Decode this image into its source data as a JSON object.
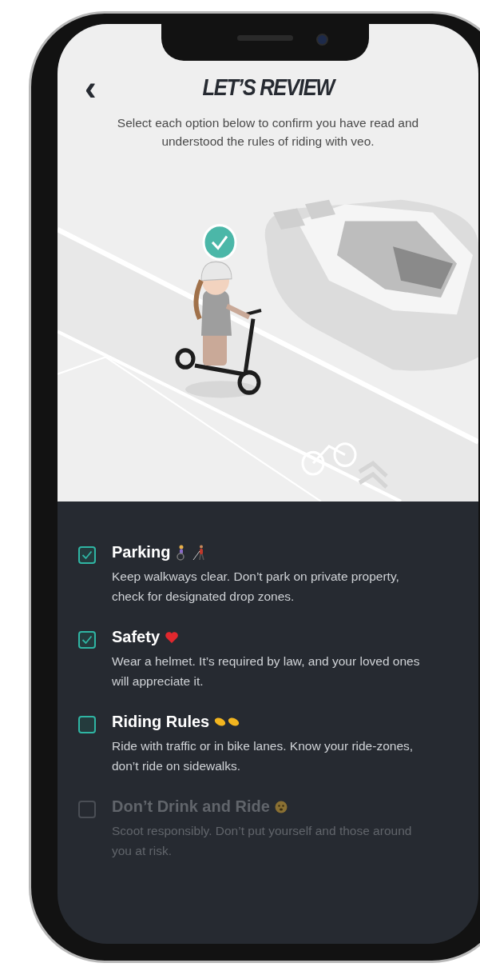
{
  "header": {
    "back": "‹",
    "title": "LET’S REVIEW",
    "subtitle": "Select each option below to confirm you have read and understood the rules of riding with veo."
  },
  "items": [
    {
      "title": "Parking",
      "description": "Keep walkways clear. Don’t park on private property, check for designated drop zones.",
      "checked": true,
      "disabled": false
    },
    {
      "title": "Safety",
      "description": "Wear a helmet. It’s required by law, and your loved ones will appreciate it.",
      "checked": true,
      "disabled": false
    },
    {
      "title": "Riding Rules",
      "description": "Ride with traffic or in  bike lanes. Know your ride-zones, don’t ride on sidewalks.",
      "checked": false,
      "disabled": false
    },
    {
      "title": "Don’t Drink and Ride",
      "description": "Scoot responsibly. Don’t put yourself and those around you at risk.",
      "checked": false,
      "disabled": true
    }
  ]
}
